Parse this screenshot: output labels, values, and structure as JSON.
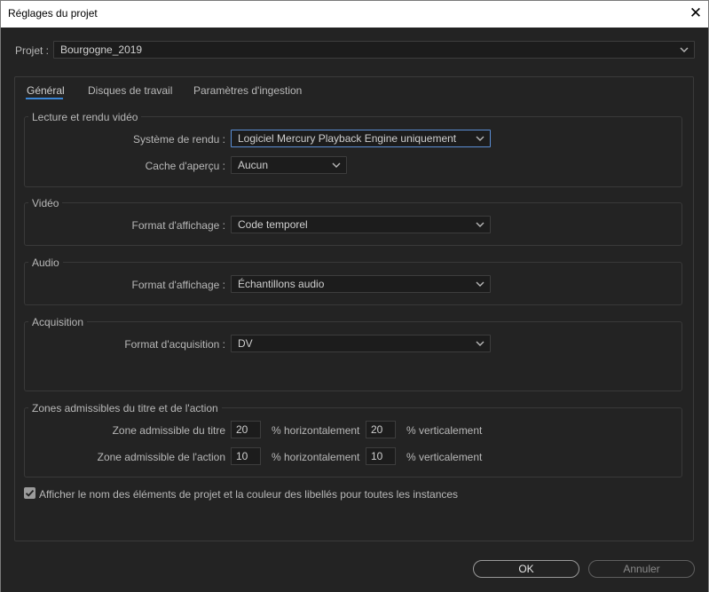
{
  "window": {
    "title": "Réglages du projet"
  },
  "project": {
    "label": "Projet :",
    "value": "Bourgogne_2019"
  },
  "tabs": [
    {
      "label": "Général"
    },
    {
      "label": "Disques de travail"
    },
    {
      "label": "Paramètres d'ingestion"
    }
  ],
  "groups": {
    "playback": {
      "title": "Lecture et rendu vidéo",
      "renderer_label": "Système de rendu :",
      "renderer_value": "Logiciel Mercury Playback Engine uniquement",
      "preview_cache_label": "Cache d'aperçu :",
      "preview_cache_value": "Aucun"
    },
    "video": {
      "title": "Vidéo",
      "display_format_label": "Format d'affichage :",
      "display_format_value": "Code temporel"
    },
    "audio": {
      "title": "Audio",
      "display_format_label": "Format d'affichage :",
      "display_format_value": "Échantillons audio"
    },
    "capture": {
      "title": "Acquisition",
      "format_label": "Format d'acquisition :",
      "format_value": "DV"
    },
    "safe_margins": {
      "title": "Zones admissibles du titre et de l'action",
      "title_safe_label": "Zone admissible du titre",
      "title_safe_h": "20",
      "title_safe_v": "20",
      "action_safe_label": "Zone admissible de l'action",
      "action_safe_h": "10",
      "action_safe_v": "10",
      "horiz_unit": "% horizontalement",
      "vert_unit": "% verticalement"
    }
  },
  "checkbox": {
    "label": "Afficher le nom des éléments de projet et la couleur des libellés pour toutes les instances",
    "checked": true
  },
  "buttons": {
    "ok": "OK",
    "cancel": "Annuler"
  },
  "colors": {
    "background": "#232323",
    "accent": "#3a86d6",
    "focus_border": "#5b8fd6"
  },
  "icons": {
    "close": "close-icon",
    "dropdown": "chevron-down-icon",
    "check": "checkmark-icon"
  }
}
